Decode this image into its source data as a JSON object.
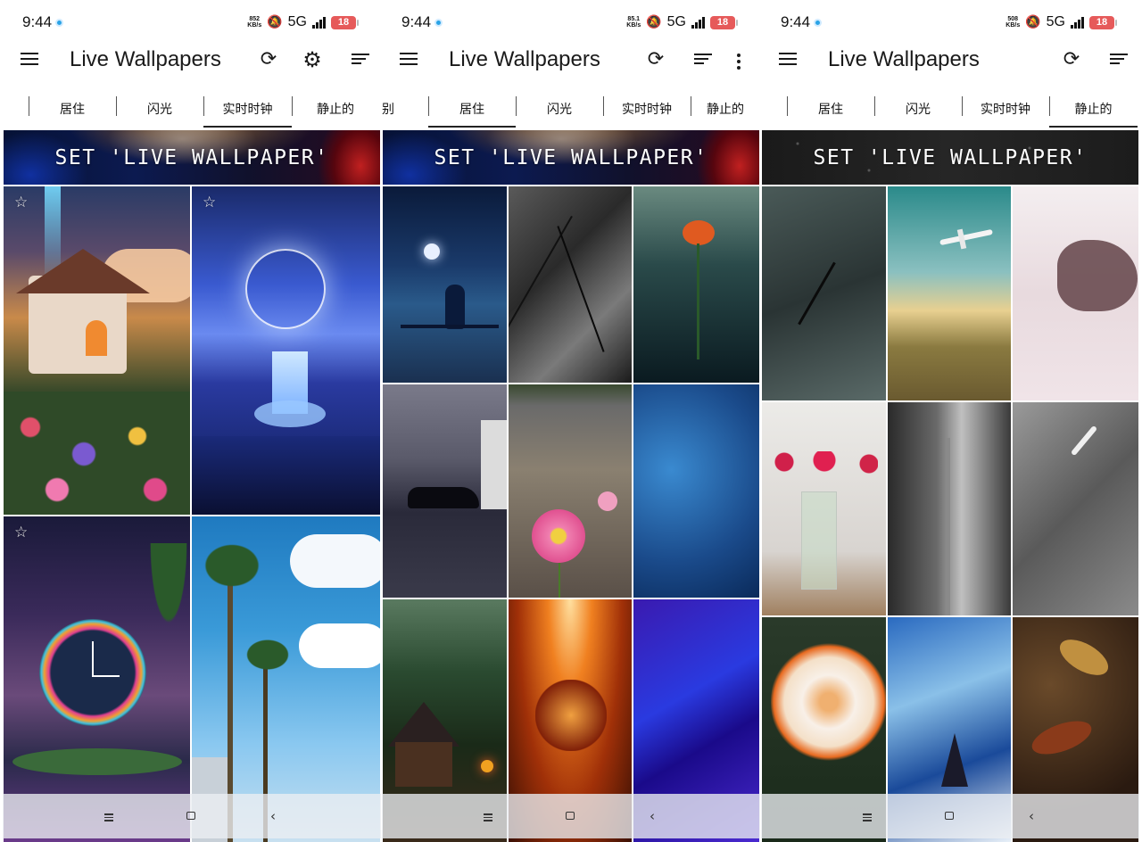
{
  "colors": {
    "text": "#1a1a1a",
    "accent_dot": "#2aa3e6",
    "battery": "#e65a5a",
    "banner_text": "#ffffff"
  },
  "screens": [
    {
      "status": {
        "time": "9:44",
        "speed_top": "852",
        "speed_bottom": "KB/s",
        "network": "5G",
        "battery": "18"
      },
      "app_bar": {
        "title": "Live Wallpapers",
        "icons": [
          "menu-icon",
          "refresh-icon",
          "settings-icon",
          "sort-icon"
        ]
      },
      "tabs": [
        {
          "label": "居住",
          "active": false
        },
        {
          "label": "闪光",
          "active": false
        },
        {
          "label": "实时时钟",
          "active": true
        },
        {
          "label": "静止的",
          "active": false
        }
      ],
      "banner": "SET 'LIVE WALLPAPER'",
      "wallpapers": [
        {
          "subject": "cottage-flowers",
          "favorite_icon": "star-outline-icon"
        },
        {
          "subject": "sun-waterfall-night",
          "favorite_icon": "star-outline-icon"
        },
        {
          "subject": "neon-clock-tropical",
          "favorite_icon": "star-outline-icon"
        },
        {
          "subject": "palm-trees-sky"
        }
      ],
      "nav": [
        "menu-nav-icon",
        "home-nav-icon",
        "back-nav-icon"
      ]
    },
    {
      "status": {
        "time": "9:44",
        "speed_top": "85.1",
        "speed_bottom": "KB/s",
        "network": "5G",
        "battery": "18"
      },
      "app_bar": {
        "title": "Live Wallpapers",
        "icons": [
          "menu-icon",
          "refresh-icon",
          "sort-icon",
          "more-vert-icon"
        ]
      },
      "tabs": [
        {
          "label": "别",
          "active": false
        },
        {
          "label": "居住",
          "active": true
        },
        {
          "label": "闪光",
          "active": false
        },
        {
          "label": "实时时钟",
          "active": false
        },
        {
          "label": "静止的",
          "active": false
        }
      ],
      "banner": "SET 'LIVE WALLPAPER'",
      "wallpapers": [
        {
          "subject": "girl-swing-moon"
        },
        {
          "subject": "bw-branches"
        },
        {
          "subject": "rose-underwater"
        },
        {
          "subject": "car-rainy-night"
        },
        {
          "subject": "pink-gerbera"
        },
        {
          "subject": "blue-sparkles"
        },
        {
          "subject": "cabin-forest"
        },
        {
          "subject": "orange-kaleidoscope"
        },
        {
          "subject": "blue-silk-waves"
        }
      ],
      "nav": [
        "menu-nav-icon",
        "home-nav-icon",
        "back-nav-icon"
      ]
    },
    {
      "status": {
        "time": "9:44",
        "speed_top": "508",
        "speed_bottom": "KB/s",
        "network": "5G",
        "battery": "18"
      },
      "app_bar": {
        "title": "Live Wallpapers",
        "icons": [
          "menu-icon",
          "refresh-icon",
          "sort-icon"
        ]
      },
      "tabs": [
        {
          "label": "居住",
          "active": false
        },
        {
          "label": "闪光",
          "active": false
        },
        {
          "label": "实时时钟",
          "active": false
        },
        {
          "label": "静止的",
          "active": true
        }
      ],
      "banner": "SET 'LIVE WALLPAPER'",
      "wallpapers": [
        {
          "subject": "gray-texture"
        },
        {
          "subject": "airplane-field"
        },
        {
          "subject": "pink-ink"
        },
        {
          "subject": "roses-vase"
        },
        {
          "subject": "bw-flower-stem"
        },
        {
          "subject": "gray-feather"
        },
        {
          "subject": "white-rose"
        },
        {
          "subject": "blue-abstract-paint"
        },
        {
          "subject": "autumn-leaves"
        }
      ],
      "nav": [
        "menu-nav-icon",
        "home-nav-icon",
        "back-nav-icon"
      ]
    }
  ]
}
